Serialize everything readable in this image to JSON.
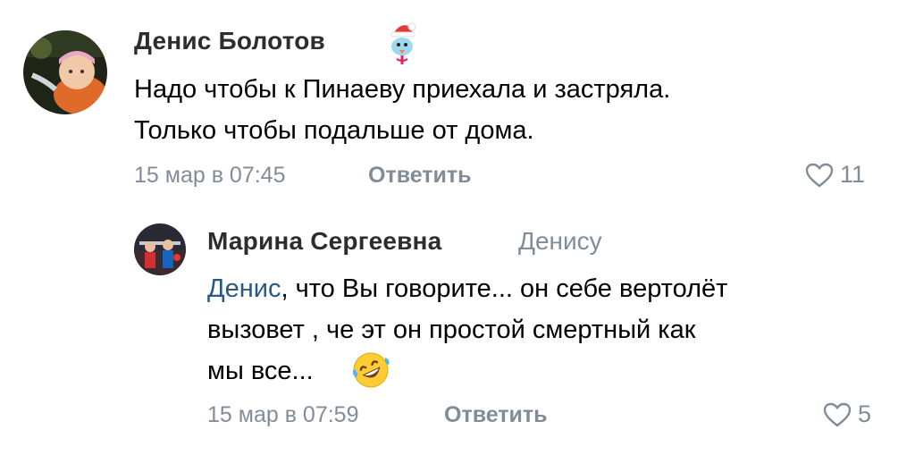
{
  "comments": [
    {
      "author": "Денис Болотов",
      "lines": [
        "Надо чтобы к Пинаеву приехала и застряла.",
        "Только чтобы подальше от дома."
      ],
      "date": "15 мар в 07:45",
      "reply_label": "Ответить",
      "likes": "11",
      "badge_icon": "santa-hat-bird-icon"
    }
  ],
  "reply": {
    "author": "Марина Сергеевна",
    "reply_to": "Денису",
    "mention": "Денис",
    "line1_rest": ", что Вы говорите... он себе вертолёт",
    "line2": "вызовет , че эт он простой смертный как",
    "line3": "мы все...",
    "emoji_icon": "rofl-emoji-icon",
    "date": "15 мар в 07:59",
    "reply_label": "Ответить",
    "likes": "5"
  },
  "colors": {
    "name": "#2c2d2e",
    "secondary": "#818c99",
    "mention": "#2a5885"
  }
}
